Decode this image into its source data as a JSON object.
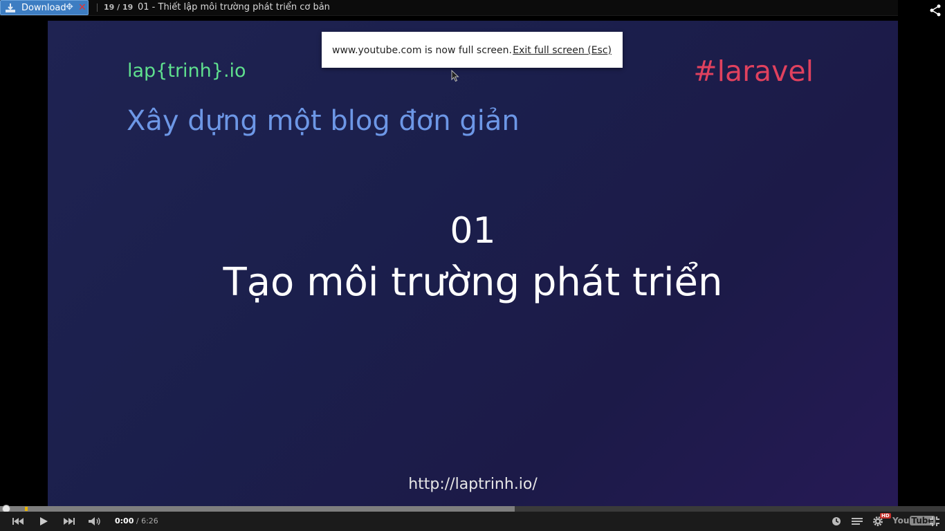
{
  "topbar": {
    "download_label": "Download",
    "counter": "19 / 19",
    "title": "01 - Thiết lập môi trường phát triển cơ bản"
  },
  "video": {
    "brand": "lap{trinh}.io",
    "hashtag": "#laravel",
    "subtitle": "Xây dựng một blog đơn giản",
    "episode_number": "01",
    "episode_title": "Tạo môi trường phát triển",
    "url": "http://laptrinh.io/"
  },
  "fullscreen_notice": {
    "message": "www.youtube.com is now full screen.",
    "exit_label": "Exit full screen (Esc)"
  },
  "player": {
    "current_time": "0:00",
    "duration": "/ 6:26",
    "buffered_fraction": 0.545,
    "played_fraction": 0.0,
    "hd_label": "HD",
    "logo_you": "You",
    "logo_tube": "Tube"
  },
  "colors": {
    "brand": "#5fe08e",
    "hashtag": "#e0415e",
    "subtitle": "#6d97e6",
    "video_bg": "#1f2352",
    "download_button": "#3d7dc2"
  }
}
